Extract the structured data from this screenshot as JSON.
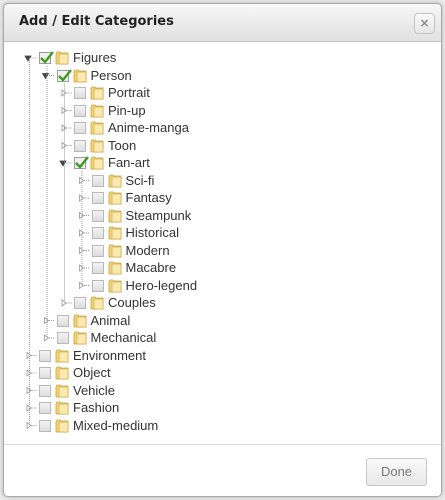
{
  "dialog": {
    "title": "Add / Edit Categories",
    "close_glyph": "×",
    "close_icon": "close-icon",
    "done_label": "Done"
  },
  "colors": {
    "check": "#3c9a1f",
    "folder_fill": "#f4d47a",
    "folder_stroke": "#c8a23c",
    "tree_line": "#9a9a9a"
  },
  "tree": [
    {
      "label": "Figures",
      "level": 0,
      "checked": true,
      "expanded": true,
      "children": [
        {
          "label": "Person",
          "level": 1,
          "checked": true,
          "expanded": true,
          "children": [
            {
              "label": "Portrait",
              "level": 2,
              "checked": false
            },
            {
              "label": "Pin-up",
              "level": 2,
              "checked": false
            },
            {
              "label": "Anime-manga",
              "level": 2,
              "checked": false
            },
            {
              "label": "Toon",
              "level": 2,
              "checked": false
            },
            {
              "label": "Fan-art",
              "level": 2,
              "checked": true,
              "expanded": true,
              "children": [
                {
                  "label": "Sci-fi",
                  "level": 3,
                  "checked": false
                },
                {
                  "label": "Fantasy",
                  "level": 3,
                  "checked": false
                },
                {
                  "label": "Steampunk",
                  "level": 3,
                  "checked": false
                },
                {
                  "label": "Historical",
                  "level": 3,
                  "checked": false
                },
                {
                  "label": "Modern",
                  "level": 3,
                  "checked": false
                },
                {
                  "label": "Macabre",
                  "level": 3,
                  "checked": false
                },
                {
                  "label": "Hero-legend",
                  "level": 3,
                  "checked": false
                }
              ]
            },
            {
              "label": "Couples",
              "level": 2,
              "checked": false
            }
          ]
        },
        {
          "label": "Animal",
          "level": 1,
          "checked": false
        },
        {
          "label": "Mechanical",
          "level": 1,
          "checked": false
        }
      ]
    },
    {
      "label": "Environment",
      "level": 0,
      "checked": false
    },
    {
      "label": "Object",
      "level": 0,
      "checked": false
    },
    {
      "label": "Vehicle",
      "level": 0,
      "checked": false
    },
    {
      "label": "Fashion",
      "level": 0,
      "checked": false
    },
    {
      "label": "Mixed-medium",
      "level": 0,
      "checked": false
    }
  ]
}
